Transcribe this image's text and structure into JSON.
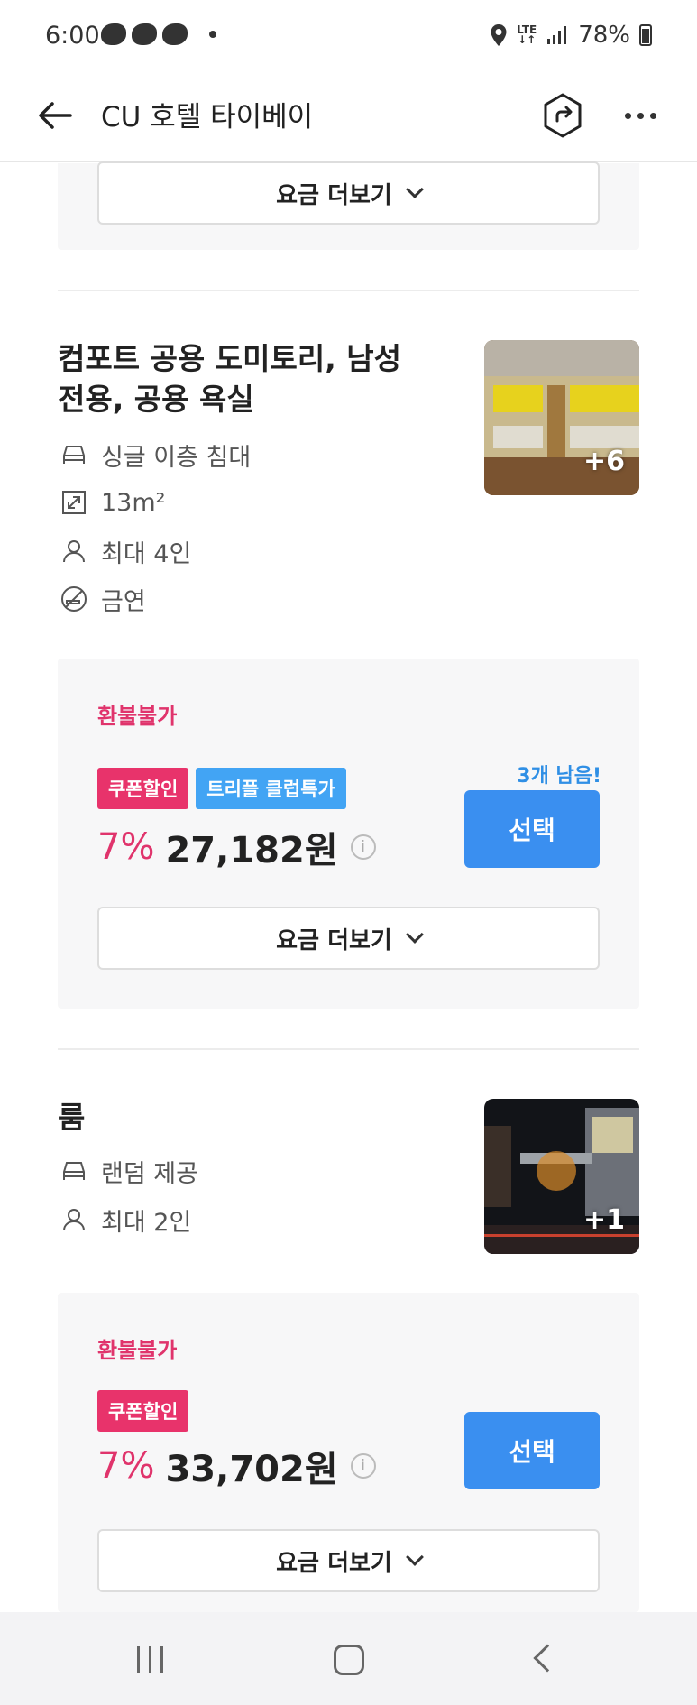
{
  "status_bar": {
    "time": "6:00",
    "network": "LTE",
    "battery": "78%"
  },
  "header": {
    "title": "CU 호텔 타이베이"
  },
  "more_rates_label": "요금 더보기",
  "rooms": [
    {
      "name_line1": "컴포트 공용 도미토리, 남성",
      "name_line2": "전용, 공용 욕실",
      "features": {
        "bed": "싱글 이층 침대",
        "size": "13m²",
        "capacity": "최대 4인",
        "smoking": "금연"
      },
      "photo_more": "+6",
      "rate": {
        "refund_policy": "환불불가",
        "badges": [
          "쿠폰할인",
          "트리플 클럽특가"
        ],
        "discount": "7%",
        "price": "27,182원",
        "remaining": "3개 남음!",
        "select_label": "선택"
      }
    },
    {
      "name": "룸",
      "features": {
        "bed": "랜덤 제공",
        "capacity": "최대 2인"
      },
      "photo_more": "+1",
      "rate": {
        "refund_policy": "환불불가",
        "badges": [
          "쿠폰할인"
        ],
        "discount": "7%",
        "price": "33,702원",
        "select_label": "선택"
      }
    }
  ],
  "colors": {
    "accent_blue": "#3a8ff0",
    "discount_pink": "#e0346c",
    "badge_triple": "#42a4f4"
  }
}
